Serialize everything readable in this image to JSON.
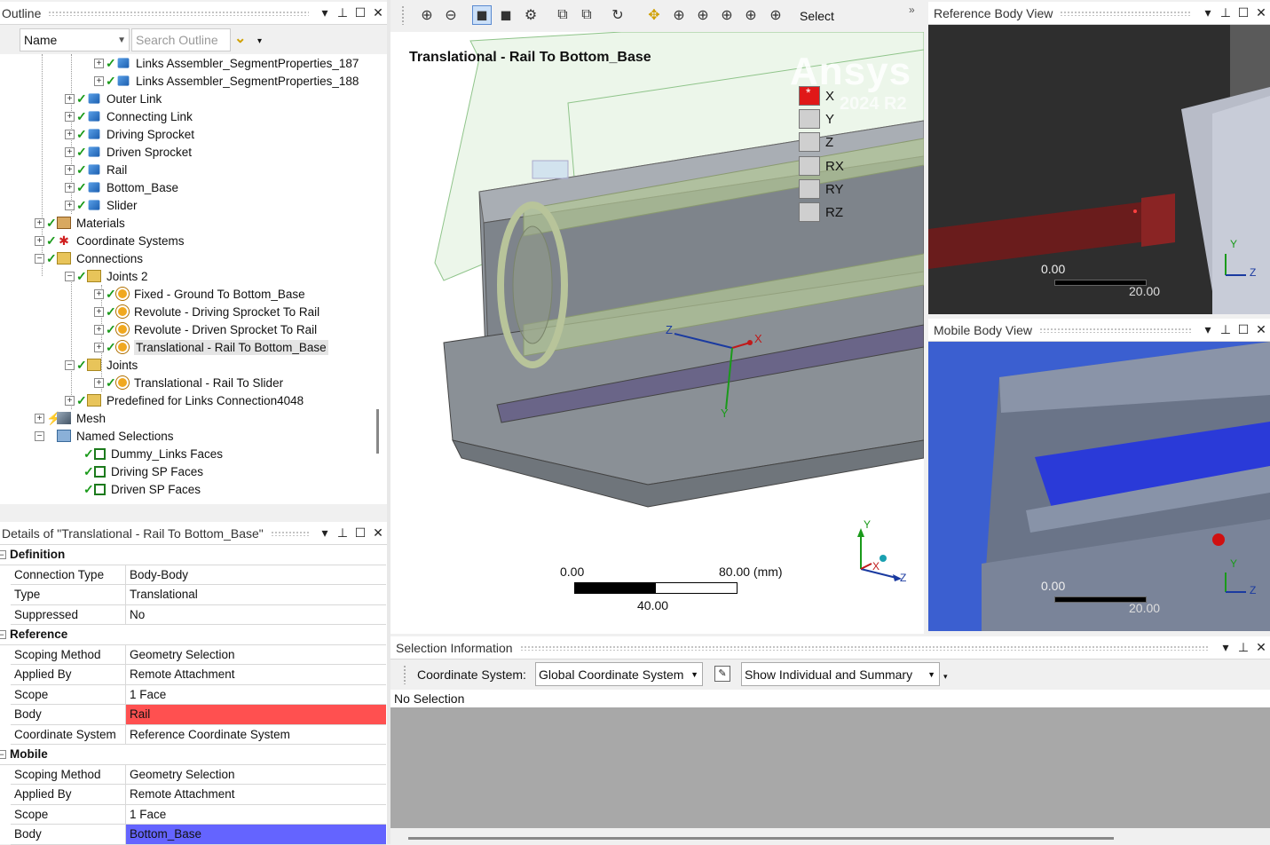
{
  "outline": {
    "title": "Outline",
    "name_filter": "Name",
    "search_placeholder": "Search Outline",
    "items": [
      {
        "label": "Links Assembler_SegmentProperties_187"
      },
      {
        "label": "Links Assembler_SegmentProperties_188"
      },
      {
        "label": "Outer Link"
      },
      {
        "label": "Connecting Link"
      },
      {
        "label": "Driving Sprocket"
      },
      {
        "label": "Driven Sprocket"
      },
      {
        "label": "Rail"
      },
      {
        "label": "Bottom_Base"
      },
      {
        "label": "Slider"
      },
      {
        "label": "Materials"
      },
      {
        "label": "Coordinate Systems"
      },
      {
        "label": "Connections"
      },
      {
        "label": "Joints 2"
      },
      {
        "label": "Fixed - Ground To Bottom_Base"
      },
      {
        "label": "Revolute - Driving Sprocket To Rail"
      },
      {
        "label": "Revolute - Driven Sprocket To Rail"
      },
      {
        "label": "Translational - Rail To Bottom_Base"
      },
      {
        "label": "Joints"
      },
      {
        "label": "Translational - Rail To Slider"
      },
      {
        "label": "Predefined for Links Connection4048"
      },
      {
        "label": "Mesh"
      },
      {
        "label": "Named Selections"
      },
      {
        "label": "Dummy_Links Faces"
      },
      {
        "label": "Driving SP Faces"
      },
      {
        "label": "Driven SP Faces"
      }
    ]
  },
  "details": {
    "title": "Details of \"Translational - Rail To Bottom_Base\"",
    "groups": [
      {
        "label": "Definition",
        "rows": [
          {
            "k": "Connection Type",
            "v": "Body-Body"
          },
          {
            "k": "Type",
            "v": "Translational"
          },
          {
            "k": "Suppressed",
            "v": "No"
          }
        ]
      },
      {
        "label": "Reference",
        "rows": [
          {
            "k": "Scoping Method",
            "v": "Geometry Selection"
          },
          {
            "k": "Applied By",
            "v": "Remote Attachment"
          },
          {
            "k": "Scope",
            "v": "1 Face"
          },
          {
            "k": "Body",
            "v": "Rail"
          },
          {
            "k": "Coordinate System",
            "v": "Reference Coordinate System"
          }
        ]
      },
      {
        "label": "Mobile",
        "rows": [
          {
            "k": "Scoping Method",
            "v": "Geometry Selection"
          },
          {
            "k": "Applied By",
            "v": "Remote Attachment"
          },
          {
            "k": "Scope",
            "v": "1 Face"
          },
          {
            "k": "Body",
            "v": "Bottom_Base"
          }
        ]
      }
    ],
    "colors": {
      "reference_body": "#ff5050",
      "mobile_body": "#6464ff"
    }
  },
  "toolbar": {
    "select_label": "Select"
  },
  "viewport": {
    "title": "Translational - Rail To Bottom_Base",
    "brand": "Ansys",
    "version": "2024 R2",
    "dof": [
      "X",
      "Y",
      "Z",
      "RX",
      "RY",
      "RZ"
    ],
    "dof_active": "X",
    "scale": {
      "start": "0.00",
      "mid": "40.00",
      "end": "80.00 (mm)"
    },
    "axes": {
      "x": "X",
      "y": "Y",
      "z": "Z"
    }
  },
  "reference_view": {
    "title": "Reference Body View",
    "scale_start": "0.00",
    "scale_end": "20.00",
    "axes": {
      "y": "Y",
      "z": "Z",
      "x": "X"
    }
  },
  "mobile_view": {
    "title": "Mobile Body View",
    "scale_start": "0.00",
    "scale_end": "20.00",
    "axes": {
      "y": "Y",
      "z": "Z",
      "x": "X"
    }
  },
  "selection": {
    "title": "Selection Information",
    "cs_label": "Coordinate System:",
    "cs_value": "Global Coordinate System",
    "mode_value": "Show Individual and Summary",
    "status": "No Selection"
  }
}
